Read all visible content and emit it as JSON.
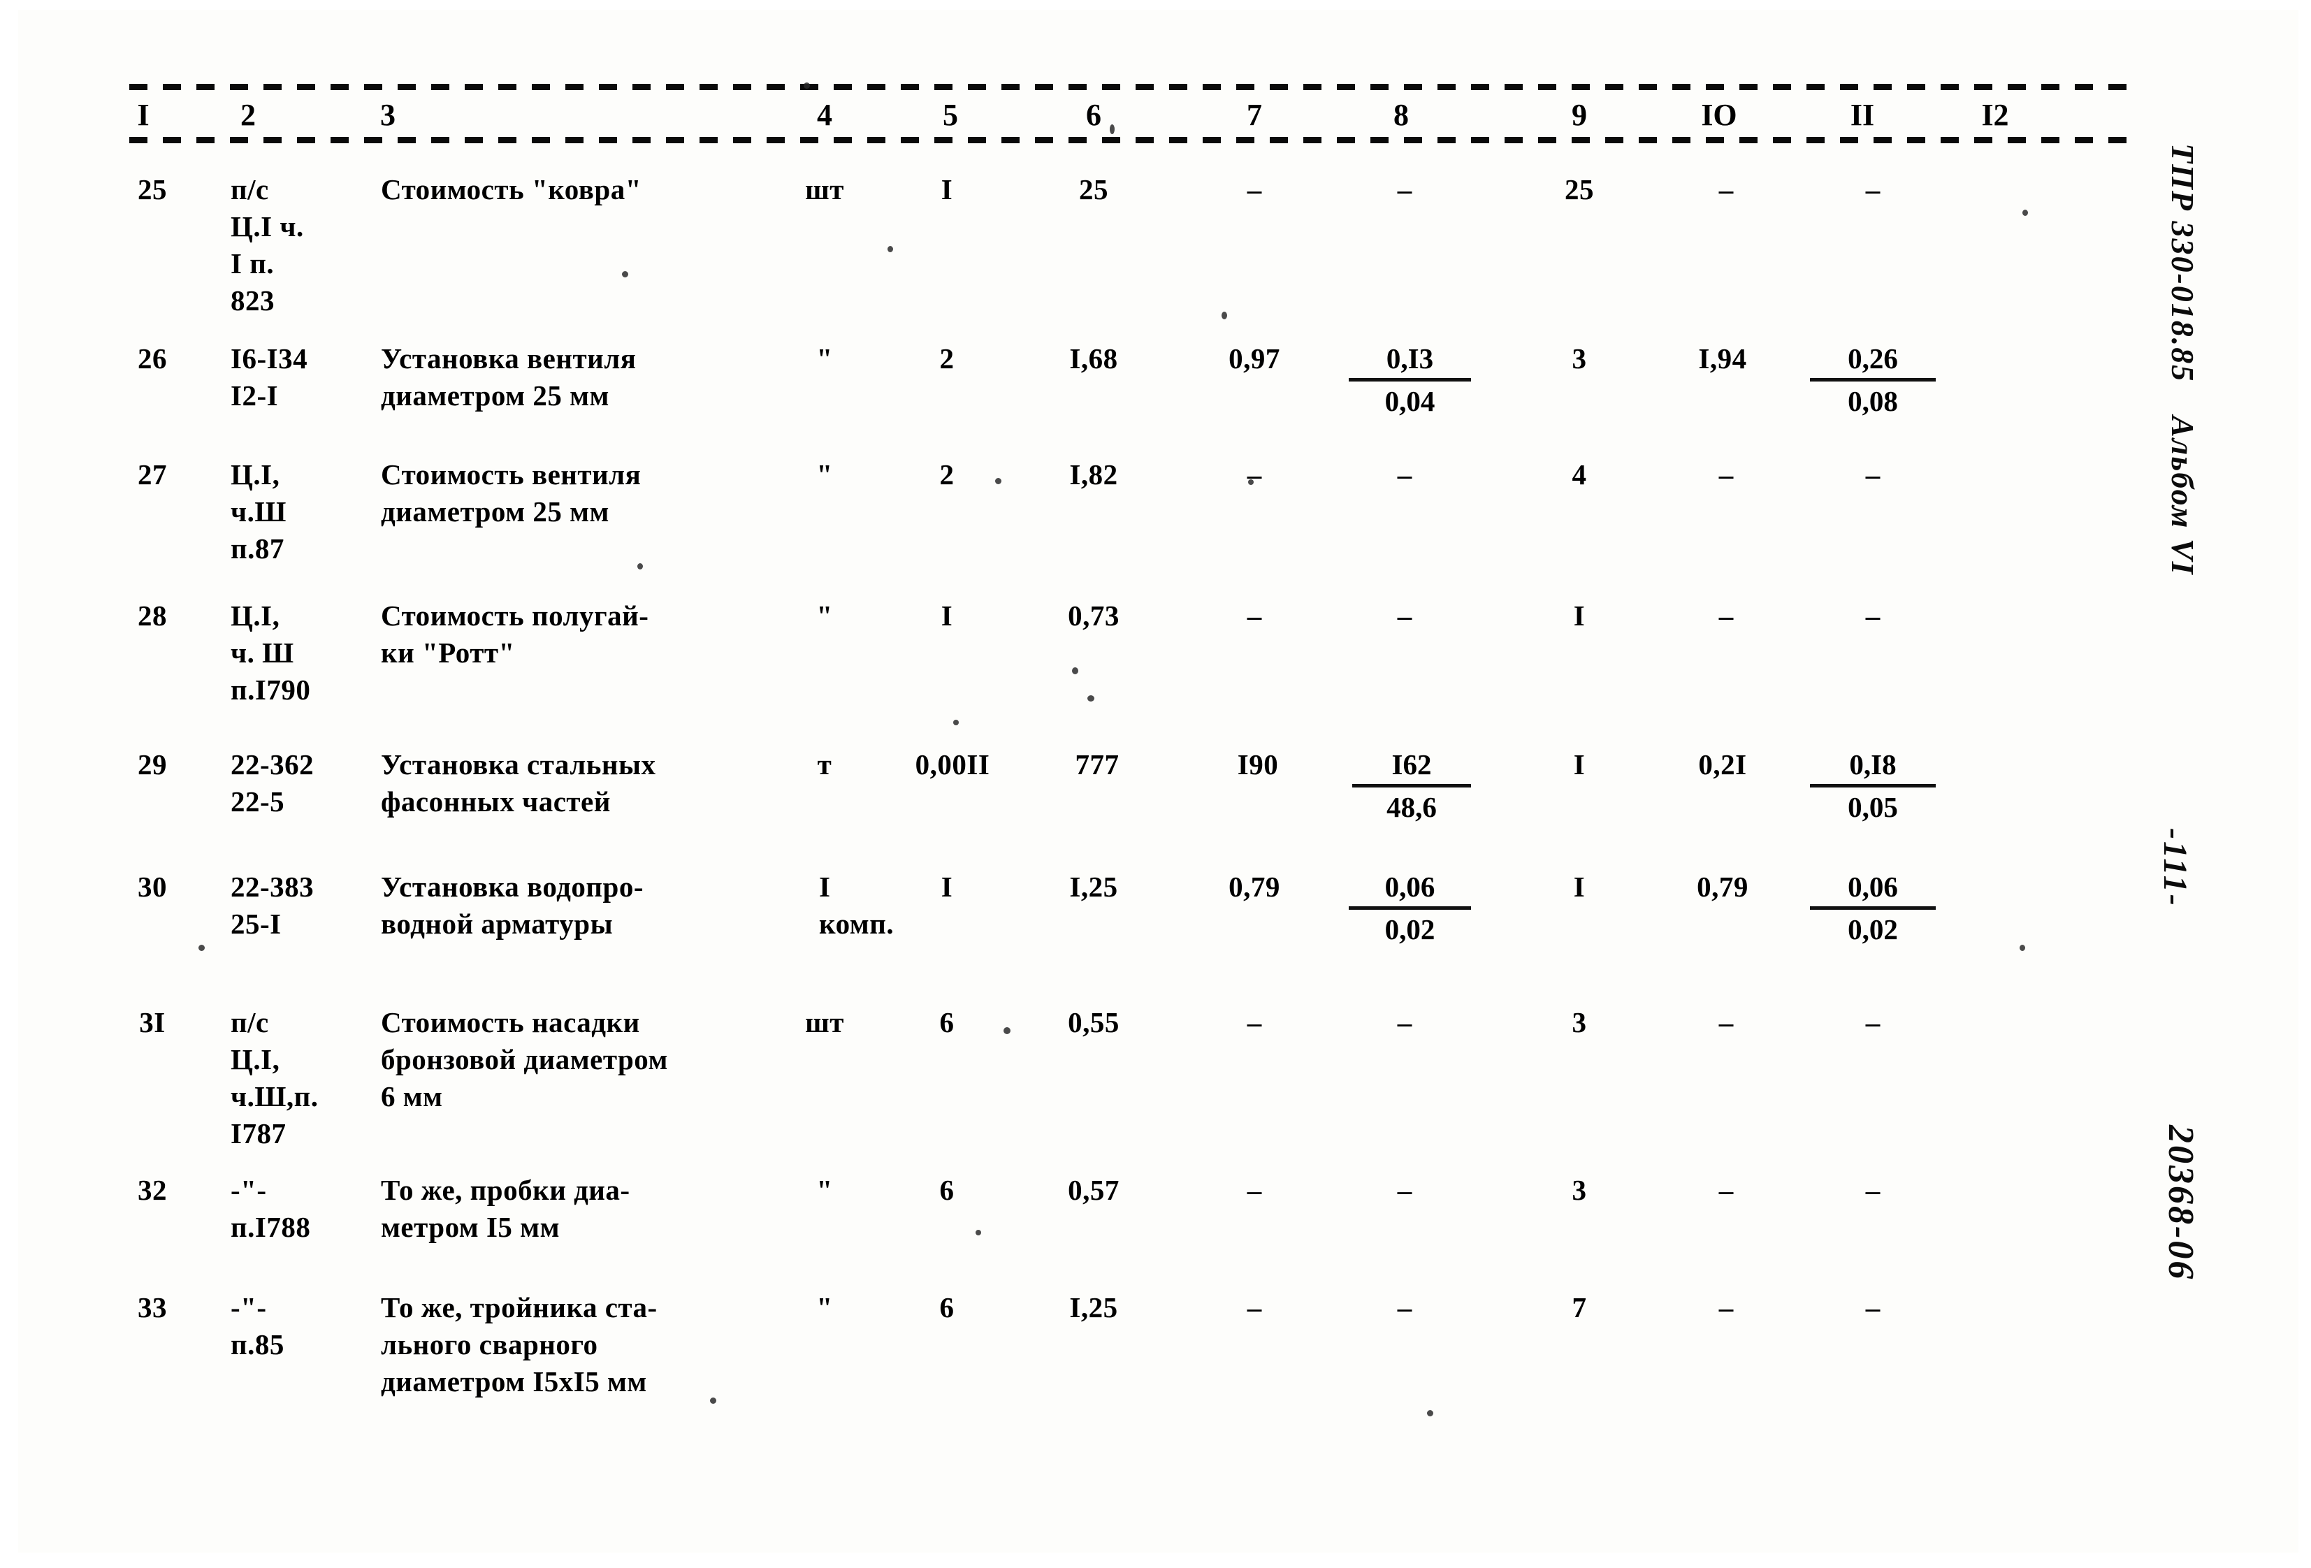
{
  "document": {
    "type": "scanned-estimate-table",
    "language": "ru"
  },
  "table": {
    "column_headers": [
      "I",
      "2",
      "3",
      "4",
      "5",
      "6",
      "7",
      "8",
      "9",
      "IO",
      "II",
      "I2"
    ],
    "rows": [
      {
        "no": "25",
        "code": "п/с\nЦ.I ч.\nI п.\n823",
        "name": "Стоимость \"ковра\"",
        "unit": "шт",
        "c5": "I",
        "c6": "25",
        "c7": "–",
        "c8_top": "–",
        "c8_bot": "",
        "c9": "25",
        "c10": "–",
        "c11_top": "–",
        "c11_bot": "",
        "c12": ""
      },
      {
        "no": "26",
        "code": "I6-I34\nI2-I",
        "name": "Установка   вентиля\nдиаметром 25 мм",
        "unit": "\"",
        "c5": "2",
        "c6": "I,68",
        "c7": "0,97",
        "c8_top": "0,I3",
        "c8_bot": "0,04",
        "c9": "3",
        "c10": "I,94",
        "c11_top": "0,26",
        "c11_bot": "0,08",
        "c12": ""
      },
      {
        "no": "27",
        "code": "Ц.I,\nч.Ш\nп.87",
        "name": "Стоимость вентиля\nдиаметром 25 мм",
        "unit": "\"",
        "c5": "2",
        "c6": "I,82",
        "c7": "–",
        "c8_top": "–",
        "c8_bot": "",
        "c9": "4",
        "c10": "–",
        "c11_top": "–",
        "c11_bot": "",
        "c12": ""
      },
      {
        "no": "28",
        "code": "Ц.I,\nч. Ш\nп.I790",
        "name": "Стоимость полугай-\nки \"Ротт\"",
        "unit": "\"",
        "c5": "I",
        "c6": "0,73",
        "c7": "–",
        "c8_top": "–",
        "c8_bot": "",
        "c9": "I",
        "c10": "–",
        "c11_top": "–",
        "c11_bot": "",
        "c12": ""
      },
      {
        "no": "29",
        "code": "22-362\n22-5",
        "name": "Установка стальных\nфасонных частей",
        "unit": "т",
        "c5": "0,00II",
        "c6": "777",
        "c7": "I90",
        "c8_top": "I62",
        "c8_bot": "48,6",
        "c9": "I",
        "c10": "0,2I",
        "c11_top": "0,I8",
        "c11_bot": "0,05",
        "c12": ""
      },
      {
        "no": "30",
        "code": "22-383\n25-I",
        "name": "Установка водопро-\nводной арматуры",
        "unit": "I\nкомп.",
        "c5": "I",
        "c6": "I,25",
        "c7": "0,79",
        "c8_top": "0,06",
        "c8_bot": "0,02",
        "c9": "I",
        "c10": "0,79",
        "c11_top": "0,06",
        "c11_bot": "0,02",
        "c12": ""
      },
      {
        "no": "3I",
        "code": "п/с\nЦ.I,\nч.Ш,п.\nI787",
        "name": "Стоимость насадки\nбронзовой диаметром\n6 мм",
        "unit": "шт",
        "c5": "6",
        "c6": "0,55",
        "c7": "–",
        "c8_top": "–",
        "c8_bot": "",
        "c9": "3",
        "c10": "–",
        "c11_top": "–",
        "c11_bot": "",
        "c12": ""
      },
      {
        "no": "32",
        "code": "-\"-\nп.I788",
        "name": "То же, пробки диа-\nметром I5 мм",
        "unit": "\"",
        "c5": "6",
        "c6": "0,57",
        "c7": "–",
        "c8_top": "–",
        "c8_bot": "",
        "c9": "3",
        "c10": "–",
        "c11_top": "–",
        "c11_bot": "",
        "c12": ""
      },
      {
        "no": "33",
        "code": "-\"-\nп.85",
        "name": "То же, тройника ста-\nльного сварного\nдиаметром I5хI5 мм",
        "unit": "\"",
        "c5": "6",
        "c6": "I,25",
        "c7": "–",
        "c8_top": "–",
        "c8_bot": "",
        "c9": "7",
        "c10": "–",
        "c11_top": "–",
        "c11_bot": "",
        "c12": ""
      }
    ]
  },
  "margin_notes": {
    "top": "ТПР 330-018.85",
    "album": "Альбом VI",
    "page_number": "-111-",
    "bottom_code": "20368-06"
  }
}
